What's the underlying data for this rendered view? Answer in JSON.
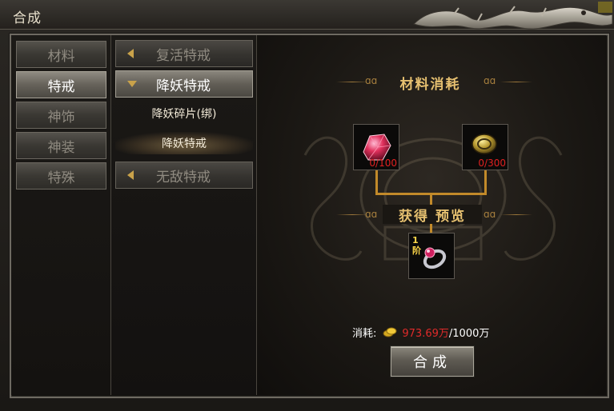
{
  "window": {
    "title": "合成"
  },
  "categories": [
    {
      "label": "材料",
      "active": false
    },
    {
      "label": "特戒",
      "active": true
    },
    {
      "label": "神饰",
      "active": false
    },
    {
      "label": "神装",
      "active": false
    },
    {
      "label": "特殊",
      "active": false
    }
  ],
  "subcategories": {
    "group1": {
      "label": "复活特戒",
      "expanded": false
    },
    "group2": {
      "label": "降妖特戒",
      "expanded": true
    },
    "group2_items": [
      {
        "label": "降妖碎片(绑)",
        "selected": false
      },
      {
        "label": "降妖特戒",
        "selected": true
      }
    ],
    "group3": {
      "label": "无敌特戒",
      "expanded": false
    }
  },
  "recipe": {
    "materials_title": "材料消耗",
    "preview_title": "获得 预览",
    "materials": [
      {
        "icon": "red-gem-icon",
        "quantity": "0/100"
      },
      {
        "icon": "gold-coin-material-icon",
        "quantity": "0/300"
      }
    ],
    "result": {
      "icon": "ring-icon",
      "tier_num": "1",
      "tier_char": "阶"
    }
  },
  "cost": {
    "label": "消耗:",
    "current": "973.69万",
    "max": "/1000万"
  },
  "craft_button": {
    "label": "合成"
  },
  "colors": {
    "accent_gold": "#e6c070",
    "quantity_red": "#e02020"
  }
}
